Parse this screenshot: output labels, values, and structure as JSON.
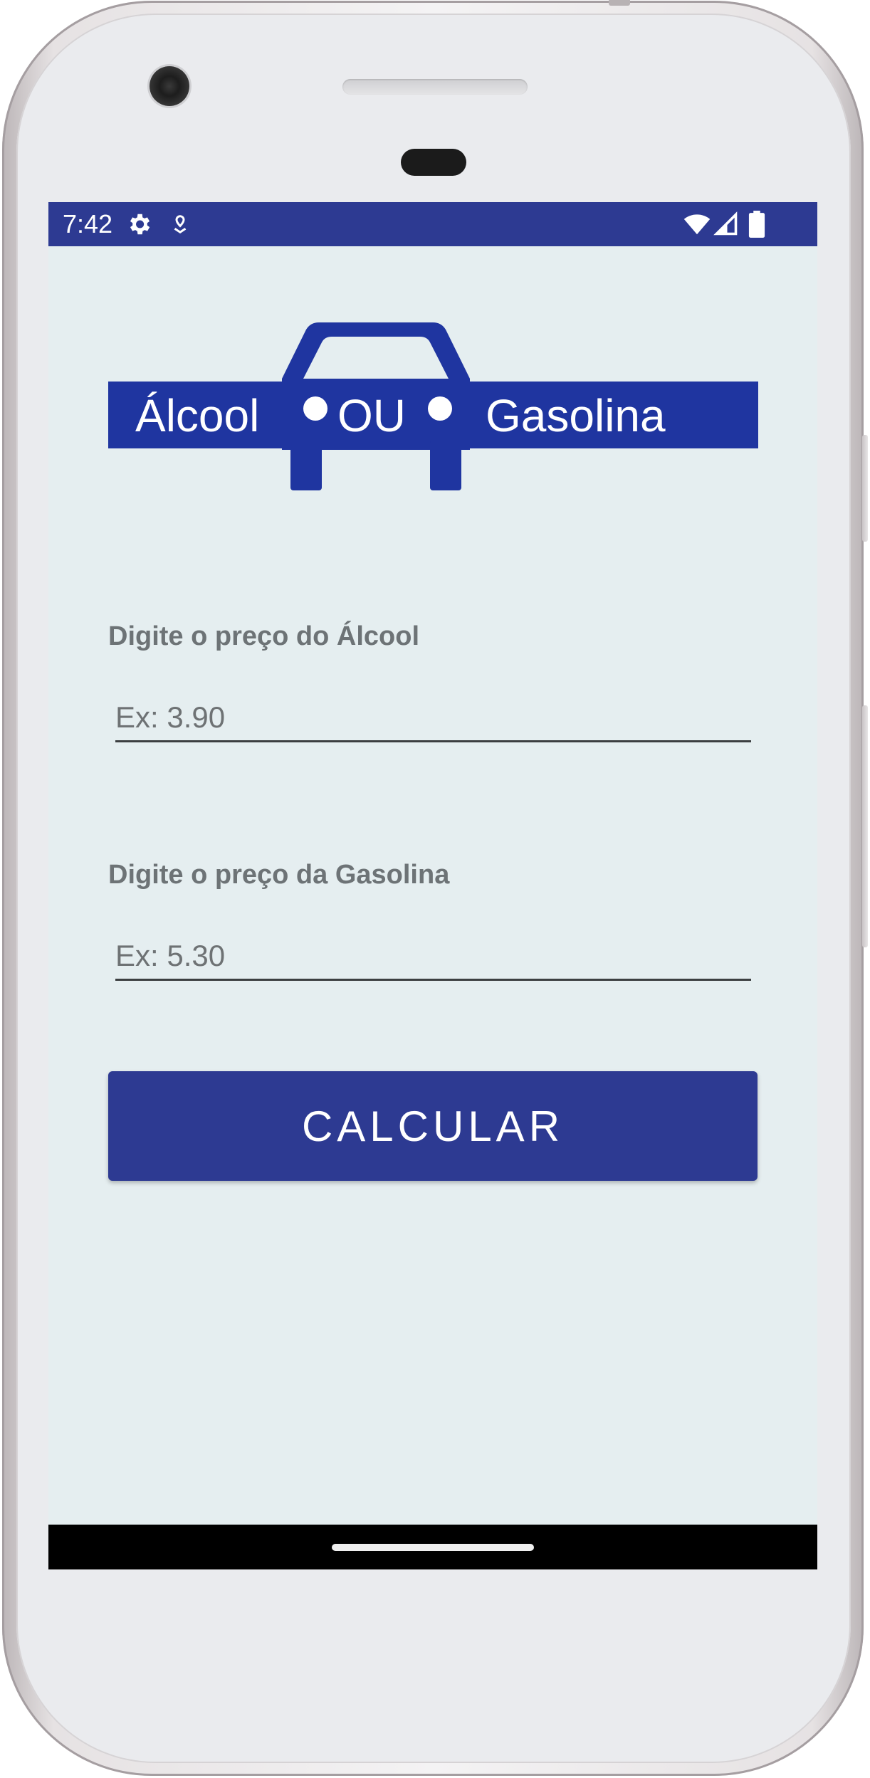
{
  "status_bar": {
    "time": "7:42",
    "icons": [
      "gear-icon",
      "location-pin-icon",
      "wifi-icon",
      "cellular-signal-icon",
      "battery-icon"
    ],
    "background_color": "#2d3a92"
  },
  "logo": {
    "word_left": "Álcool",
    "word_middle": "OU",
    "word_right": "Gasolina",
    "color": "#1f35a0"
  },
  "form": {
    "alcohol_label": "Digite o preço do Álcool",
    "alcohol_placeholder": "Ex: 3.90",
    "gasoline_label": "Digite o preço da Gasolina",
    "gasoline_placeholder": "Ex: 5.30",
    "calculate_label": "CALCULAR"
  },
  "colors": {
    "screen_background": "#e5eef0",
    "accent": "#2d3a92",
    "label_text": "#6d7376"
  }
}
